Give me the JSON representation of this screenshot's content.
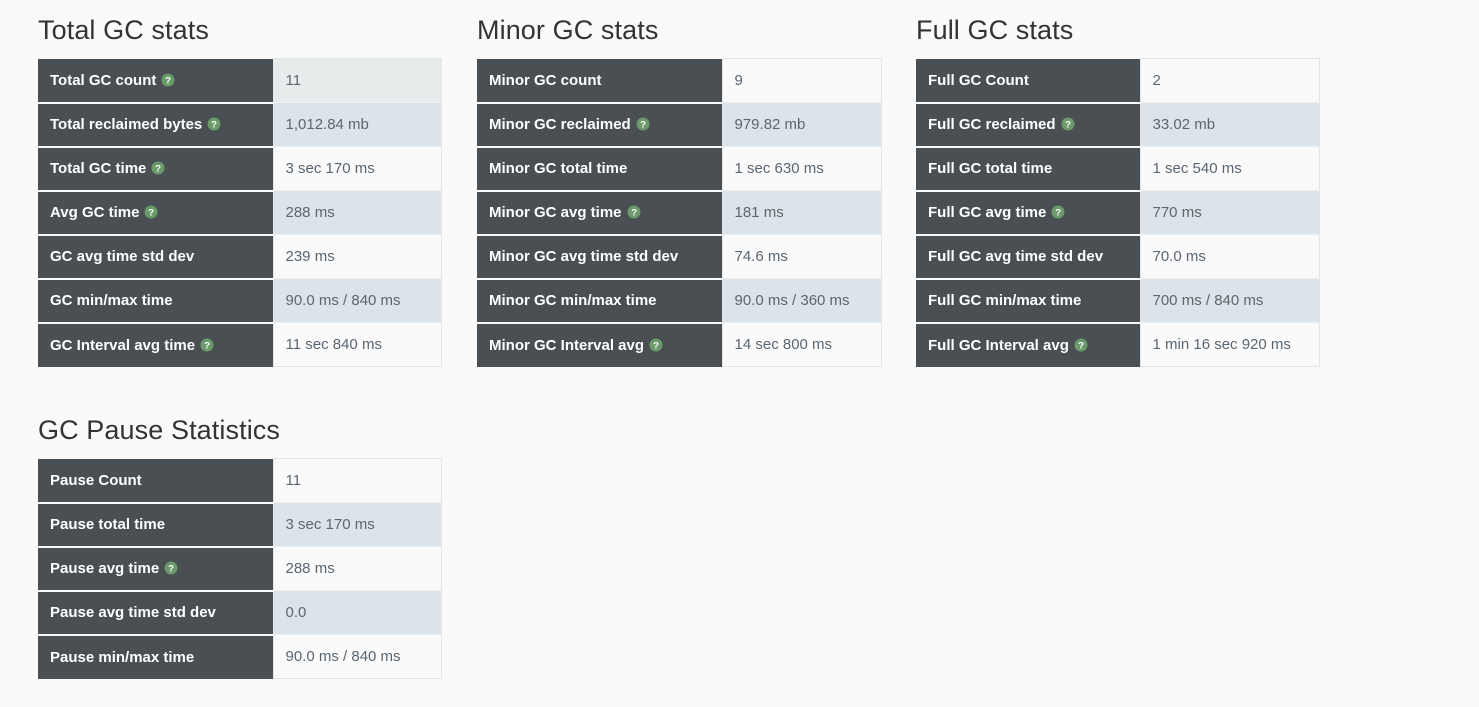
{
  "colors": {
    "page_background": "#fafafa",
    "label_cell": "#4a4f54",
    "label_text": "#ffffff",
    "value_text": "#5a6672",
    "row_gray": "#e8ebec",
    "row_blue": "#dde4e9",
    "row_white": "#fafafa",
    "help_icon_green": "#6b9a6b",
    "heading_text": "#333333"
  },
  "panels": {
    "total": {
      "title": "Total GC stats",
      "rows": [
        {
          "label": "Total GC count",
          "help": true,
          "value": "11",
          "shade": "gray"
        },
        {
          "label": "Total reclaimed bytes",
          "help": true,
          "value": "1,012.84 mb",
          "shade": "blue"
        },
        {
          "label": "Total GC time",
          "help": true,
          "value": "3 sec 170 ms",
          "shade": "white"
        },
        {
          "label": "Avg GC time",
          "help": true,
          "value": "288 ms",
          "shade": "blue"
        },
        {
          "label": "GC avg time std dev",
          "help": false,
          "value": "239 ms",
          "shade": "white"
        },
        {
          "label": "GC min/max time",
          "help": false,
          "value": "90.0 ms / 840 ms",
          "shade": "blue"
        },
        {
          "label": "GC Interval avg time",
          "help": true,
          "value": "11 sec 840 ms",
          "shade": "white"
        }
      ]
    },
    "minor": {
      "title": "Minor GC stats",
      "rows": [
        {
          "label": "Minor GC count",
          "help": false,
          "value": "9",
          "shade": "white"
        },
        {
          "label": "Minor GC reclaimed",
          "help": true,
          "value": "979.82 mb",
          "shade": "blue"
        },
        {
          "label": "Minor GC total time",
          "help": false,
          "value": "1 sec 630 ms",
          "shade": "white"
        },
        {
          "label": "Minor GC avg time",
          "help": true,
          "value": "181 ms",
          "shade": "blue"
        },
        {
          "label": "Minor GC avg time std dev",
          "help": false,
          "value": "74.6 ms",
          "shade": "white"
        },
        {
          "label": "Minor GC min/max time",
          "help": false,
          "value": "90.0 ms / 360 ms",
          "shade": "blue"
        },
        {
          "label": "Minor GC Interval avg",
          "help": true,
          "value": "14 sec 800 ms",
          "shade": "white"
        }
      ]
    },
    "full": {
      "title": "Full GC stats",
      "rows": [
        {
          "label": "Full GC Count",
          "help": false,
          "value": "2",
          "shade": "white"
        },
        {
          "label": "Full GC reclaimed",
          "help": true,
          "value": "33.02 mb",
          "shade": "blue"
        },
        {
          "label": "Full GC total time",
          "help": false,
          "value": "1 sec 540 ms",
          "shade": "white"
        },
        {
          "label": "Full GC avg time",
          "help": true,
          "value": "770 ms",
          "shade": "blue"
        },
        {
          "label": "Full GC avg time std dev",
          "help": false,
          "value": "70.0 ms",
          "shade": "white"
        },
        {
          "label": "Full GC min/max time",
          "help": false,
          "value": "700 ms / 840 ms",
          "shade": "blue"
        },
        {
          "label": "Full GC Interval avg",
          "help": true,
          "value": "1 min 16 sec 920 ms",
          "shade": "white"
        }
      ]
    },
    "pause": {
      "title": "GC Pause Statistics",
      "rows": [
        {
          "label": "Pause Count",
          "help": false,
          "value": "11",
          "shade": "white"
        },
        {
          "label": "Pause total time",
          "help": false,
          "value": "3 sec 170 ms",
          "shade": "blue"
        },
        {
          "label": "Pause avg time",
          "help": true,
          "value": "288 ms",
          "shade": "white"
        },
        {
          "label": "Pause avg time std dev",
          "help": false,
          "value": "0.0",
          "shade": "blue"
        },
        {
          "label": "Pause min/max time",
          "help": false,
          "value": "90.0 ms / 840 ms",
          "shade": "white"
        }
      ]
    }
  },
  "icons": {
    "help": "help-circle-icon"
  }
}
